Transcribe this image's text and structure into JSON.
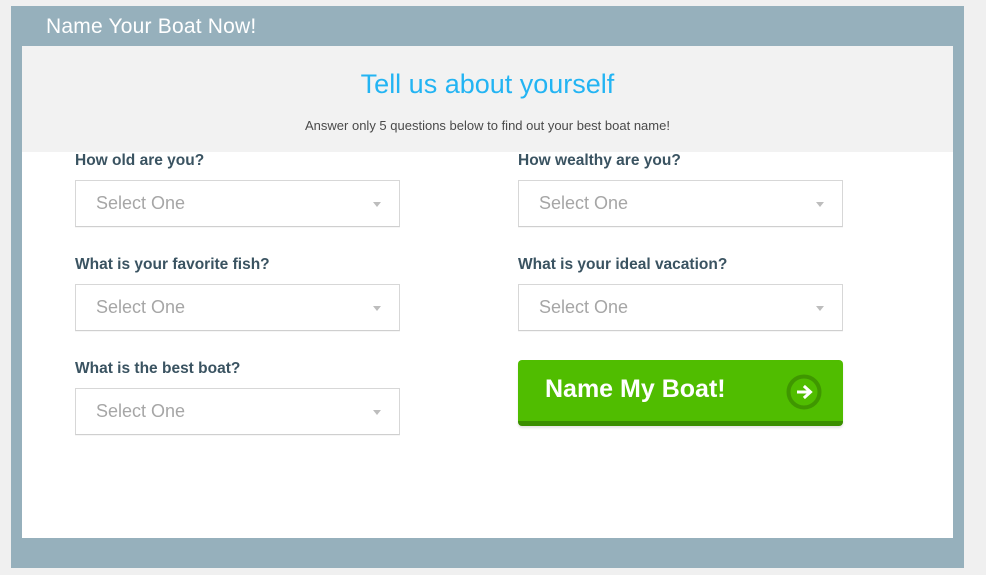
{
  "window": {
    "title": "Name Your Boat Now!",
    "frame_color": "#96b0bc"
  },
  "intro": {
    "heading": "Tell us about yourself",
    "heading_color": "#23b4f3",
    "subtext": "Answer only 5 questions below to find out your best boat name!",
    "band_color": "#f2f2f2"
  },
  "form": {
    "left_column": [
      {
        "label": "How old are you?",
        "select_value": "Select One",
        "caret_icon": "chevron-down-icon"
      },
      {
        "label": "What is your favorite fish?",
        "select_value": "Select One",
        "caret_icon": "chevron-down-icon"
      },
      {
        "label": "What is the best boat?",
        "select_value": "Select One",
        "caret_icon": "chevron-down-icon"
      }
    ],
    "right_column": [
      {
        "label": "How wealthy are you?",
        "select_value": "Select One",
        "caret_icon": "chevron-down-icon"
      },
      {
        "label": "What is your ideal vacation?",
        "select_value": "Select One",
        "caret_icon": "chevron-down-icon"
      }
    ],
    "submit": {
      "label": "Name My Boat!",
      "icon": "arrow-right-circle-icon",
      "button_color": "#50bd00",
      "button_shadow_color": "#3b8f00"
    }
  }
}
